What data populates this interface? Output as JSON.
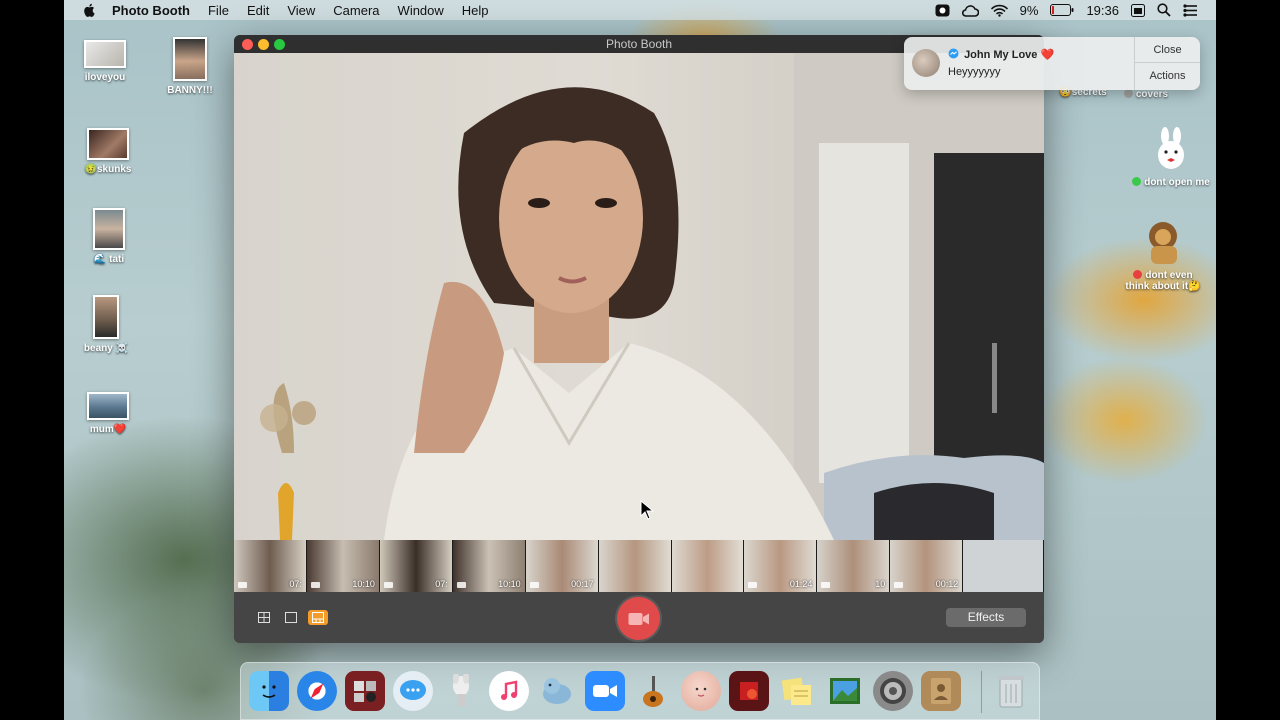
{
  "menubar": {
    "app_name": "Photo Booth",
    "menus": [
      "File",
      "Edit",
      "View",
      "Camera",
      "Window",
      "Help"
    ],
    "battery": "9%",
    "time": "19:36",
    "status_icons": [
      "screen-record-icon",
      "creative-cloud-icon",
      "wifi-icon",
      "battery-icon",
      "calendar-icon",
      "search-icon",
      "control-center-icon"
    ]
  },
  "desktop_left": [
    {
      "label": "iloveyou"
    },
    {
      "label": "BANNY!!!"
    },
    {
      "label": "skunks",
      "emoji": "🤢"
    },
    {
      "label": "tati",
      "emoji": "🌊"
    },
    {
      "label": "beany",
      "emoji": "☠️"
    },
    {
      "label": "mum",
      "emoji": "❤️"
    }
  ],
  "desktop_right": [
    {
      "label": "secrets",
      "emoji": "😳"
    },
    {
      "label": "covers",
      "tag_color": "#a0a0a0"
    },
    {
      "label": "dont open me",
      "tag_color": "#3cc84a"
    },
    {
      "label_line1": "dont even",
      "label_line2": "think about it",
      "emoji": "🤔",
      "tag_color": "#e84040"
    }
  ],
  "window": {
    "title": "Photo Booth",
    "strip_labels": [
      "07:",
      "10:10",
      "07:",
      "10:10",
      "00:17",
      "",
      "",
      "01:24",
      "10",
      "00:12"
    ],
    "effects_label": "Effects"
  },
  "notification": {
    "sender": "John My Love ❤️",
    "message": "Heyyyyyyy",
    "close_label": "Close",
    "actions_label": "Actions"
  },
  "dock": {
    "apps": [
      "finder-icon",
      "safari-icon",
      "photo-booth-icon",
      "messages-icon",
      "mail-icon",
      "music-icon",
      "seal-app-icon",
      "zoom-icon",
      "garageband-icon",
      "face-app-icon",
      "photo-booth-alt-icon",
      "stickies-icon",
      "preview-icon",
      "system-preferences-icon",
      "contacts-icon",
      "trash-icon"
    ]
  }
}
